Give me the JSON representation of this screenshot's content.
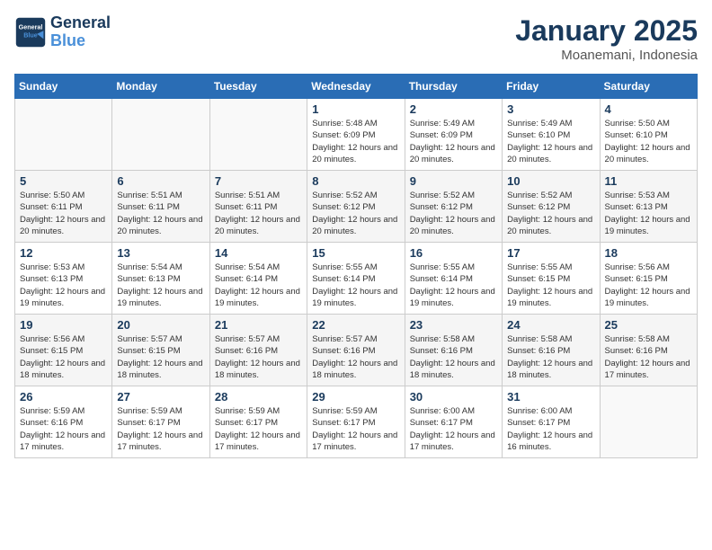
{
  "header": {
    "logo_line1": "General",
    "logo_line2": "Blue",
    "month_year": "January 2025",
    "location": "Moanemani, Indonesia"
  },
  "weekdays": [
    "Sunday",
    "Monday",
    "Tuesday",
    "Wednesday",
    "Thursday",
    "Friday",
    "Saturday"
  ],
  "weeks": [
    [
      {
        "day": "",
        "info": ""
      },
      {
        "day": "",
        "info": ""
      },
      {
        "day": "",
        "info": ""
      },
      {
        "day": "1",
        "info": "Sunrise: 5:48 AM\nSunset: 6:09 PM\nDaylight: 12 hours\nand 20 minutes."
      },
      {
        "day": "2",
        "info": "Sunrise: 5:49 AM\nSunset: 6:09 PM\nDaylight: 12 hours\nand 20 minutes."
      },
      {
        "day": "3",
        "info": "Sunrise: 5:49 AM\nSunset: 6:10 PM\nDaylight: 12 hours\nand 20 minutes."
      },
      {
        "day": "4",
        "info": "Sunrise: 5:50 AM\nSunset: 6:10 PM\nDaylight: 12 hours\nand 20 minutes."
      }
    ],
    [
      {
        "day": "5",
        "info": "Sunrise: 5:50 AM\nSunset: 6:11 PM\nDaylight: 12 hours\nand 20 minutes."
      },
      {
        "day": "6",
        "info": "Sunrise: 5:51 AM\nSunset: 6:11 PM\nDaylight: 12 hours\nand 20 minutes."
      },
      {
        "day": "7",
        "info": "Sunrise: 5:51 AM\nSunset: 6:11 PM\nDaylight: 12 hours\nand 20 minutes."
      },
      {
        "day": "8",
        "info": "Sunrise: 5:52 AM\nSunset: 6:12 PM\nDaylight: 12 hours\nand 20 minutes."
      },
      {
        "day": "9",
        "info": "Sunrise: 5:52 AM\nSunset: 6:12 PM\nDaylight: 12 hours\nand 20 minutes."
      },
      {
        "day": "10",
        "info": "Sunrise: 5:52 AM\nSunset: 6:12 PM\nDaylight: 12 hours\nand 20 minutes."
      },
      {
        "day": "11",
        "info": "Sunrise: 5:53 AM\nSunset: 6:13 PM\nDaylight: 12 hours\nand 19 minutes."
      }
    ],
    [
      {
        "day": "12",
        "info": "Sunrise: 5:53 AM\nSunset: 6:13 PM\nDaylight: 12 hours\nand 19 minutes."
      },
      {
        "day": "13",
        "info": "Sunrise: 5:54 AM\nSunset: 6:13 PM\nDaylight: 12 hours\nand 19 minutes."
      },
      {
        "day": "14",
        "info": "Sunrise: 5:54 AM\nSunset: 6:14 PM\nDaylight: 12 hours\nand 19 minutes."
      },
      {
        "day": "15",
        "info": "Sunrise: 5:55 AM\nSunset: 6:14 PM\nDaylight: 12 hours\nand 19 minutes."
      },
      {
        "day": "16",
        "info": "Sunrise: 5:55 AM\nSunset: 6:14 PM\nDaylight: 12 hours\nand 19 minutes."
      },
      {
        "day": "17",
        "info": "Sunrise: 5:55 AM\nSunset: 6:15 PM\nDaylight: 12 hours\nand 19 minutes."
      },
      {
        "day": "18",
        "info": "Sunrise: 5:56 AM\nSunset: 6:15 PM\nDaylight: 12 hours\nand 19 minutes."
      }
    ],
    [
      {
        "day": "19",
        "info": "Sunrise: 5:56 AM\nSunset: 6:15 PM\nDaylight: 12 hours\nand 18 minutes."
      },
      {
        "day": "20",
        "info": "Sunrise: 5:57 AM\nSunset: 6:15 PM\nDaylight: 12 hours\nand 18 minutes."
      },
      {
        "day": "21",
        "info": "Sunrise: 5:57 AM\nSunset: 6:16 PM\nDaylight: 12 hours\nand 18 minutes."
      },
      {
        "day": "22",
        "info": "Sunrise: 5:57 AM\nSunset: 6:16 PM\nDaylight: 12 hours\nand 18 minutes."
      },
      {
        "day": "23",
        "info": "Sunrise: 5:58 AM\nSunset: 6:16 PM\nDaylight: 12 hours\nand 18 minutes."
      },
      {
        "day": "24",
        "info": "Sunrise: 5:58 AM\nSunset: 6:16 PM\nDaylight: 12 hours\nand 18 minutes."
      },
      {
        "day": "25",
        "info": "Sunrise: 5:58 AM\nSunset: 6:16 PM\nDaylight: 12 hours\nand 17 minutes."
      }
    ],
    [
      {
        "day": "26",
        "info": "Sunrise: 5:59 AM\nSunset: 6:16 PM\nDaylight: 12 hours\nand 17 minutes."
      },
      {
        "day": "27",
        "info": "Sunrise: 5:59 AM\nSunset: 6:17 PM\nDaylight: 12 hours\nand 17 minutes."
      },
      {
        "day": "28",
        "info": "Sunrise: 5:59 AM\nSunset: 6:17 PM\nDaylight: 12 hours\nand 17 minutes."
      },
      {
        "day": "29",
        "info": "Sunrise: 5:59 AM\nSunset: 6:17 PM\nDaylight: 12 hours\nand 17 minutes."
      },
      {
        "day": "30",
        "info": "Sunrise: 6:00 AM\nSunset: 6:17 PM\nDaylight: 12 hours\nand 17 minutes."
      },
      {
        "day": "31",
        "info": "Sunrise: 6:00 AM\nSunset: 6:17 PM\nDaylight: 12 hours\nand 16 minutes."
      },
      {
        "day": "",
        "info": ""
      }
    ]
  ]
}
